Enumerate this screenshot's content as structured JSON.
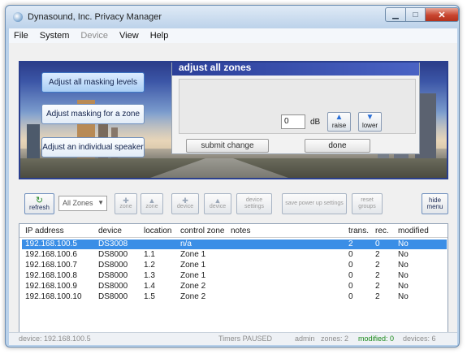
{
  "window": {
    "title": "Dynasound, Inc.  Privacy Manager",
    "close_glyph": "✕",
    "min_glyph": "▁",
    "max_glyph": "□"
  },
  "menu": [
    {
      "label": "File",
      "enabled": true
    },
    {
      "label": "System",
      "enabled": true
    },
    {
      "label": "Device",
      "enabled": false
    },
    {
      "label": "View",
      "enabled": true
    },
    {
      "label": "Help",
      "enabled": true
    }
  ],
  "banner": {
    "buttons": [
      "Adjust all masking levels",
      "Adjust masking for a zone",
      "Adjust an individual speaker"
    ],
    "active_index": 0
  },
  "panel": {
    "heading": "adjust all zones",
    "db_value": "0",
    "db_unit": "dB",
    "raise_label": "raise",
    "lower_label": "lower",
    "submit_label": "submit change",
    "done_label": "done"
  },
  "toolbar": {
    "refresh_label": "refresh",
    "zone_select": "All Zones",
    "zone_plus": "zone",
    "zone_minus": "zone",
    "device_plus": "device",
    "device_minus": "device",
    "device_settings": "device settings",
    "save_power_up": "save power up settings",
    "reset_groups": "reset groups",
    "hide_menu": "hide menu"
  },
  "table": {
    "columns": [
      "IP address",
      "device",
      "location",
      "control zone",
      "notes",
      "trans.",
      "rec.",
      "modified"
    ],
    "rows": [
      [
        "192.168.100.5",
        "DS3008",
        "",
        "n/a",
        "",
        "2",
        "0",
        "No"
      ],
      [
        "192.168.100.6",
        "DS8000",
        "1.1",
        "Zone 1",
        "",
        "0",
        "2",
        "No"
      ],
      [
        "192.168.100.7",
        "DS8000",
        "1.2",
        "Zone 1",
        "",
        "0",
        "2",
        "No"
      ],
      [
        "192.168.100.8",
        "DS8000",
        "1.3",
        "Zone 1",
        "",
        "0",
        "2",
        "No"
      ],
      [
        "192.168.100.9",
        "DS8000",
        "1.4",
        "Zone 2",
        "",
        "0",
        "2",
        "No"
      ],
      [
        "192.168.100.10",
        "DS8000",
        "1.5",
        "Zone 2",
        "",
        "0",
        "2",
        "No"
      ]
    ],
    "selected_index": 0
  },
  "status": {
    "device": "device: 192.168.100.5",
    "timer": "Timers PAUSED",
    "user": "admin",
    "zones": "zones: 2",
    "modified": "modified: 0",
    "devices": "devices: 6"
  },
  "colors": {
    "accent": "#2b3f98",
    "selection": "#3a8ee6",
    "status_ok": "#1b8a1b"
  }
}
